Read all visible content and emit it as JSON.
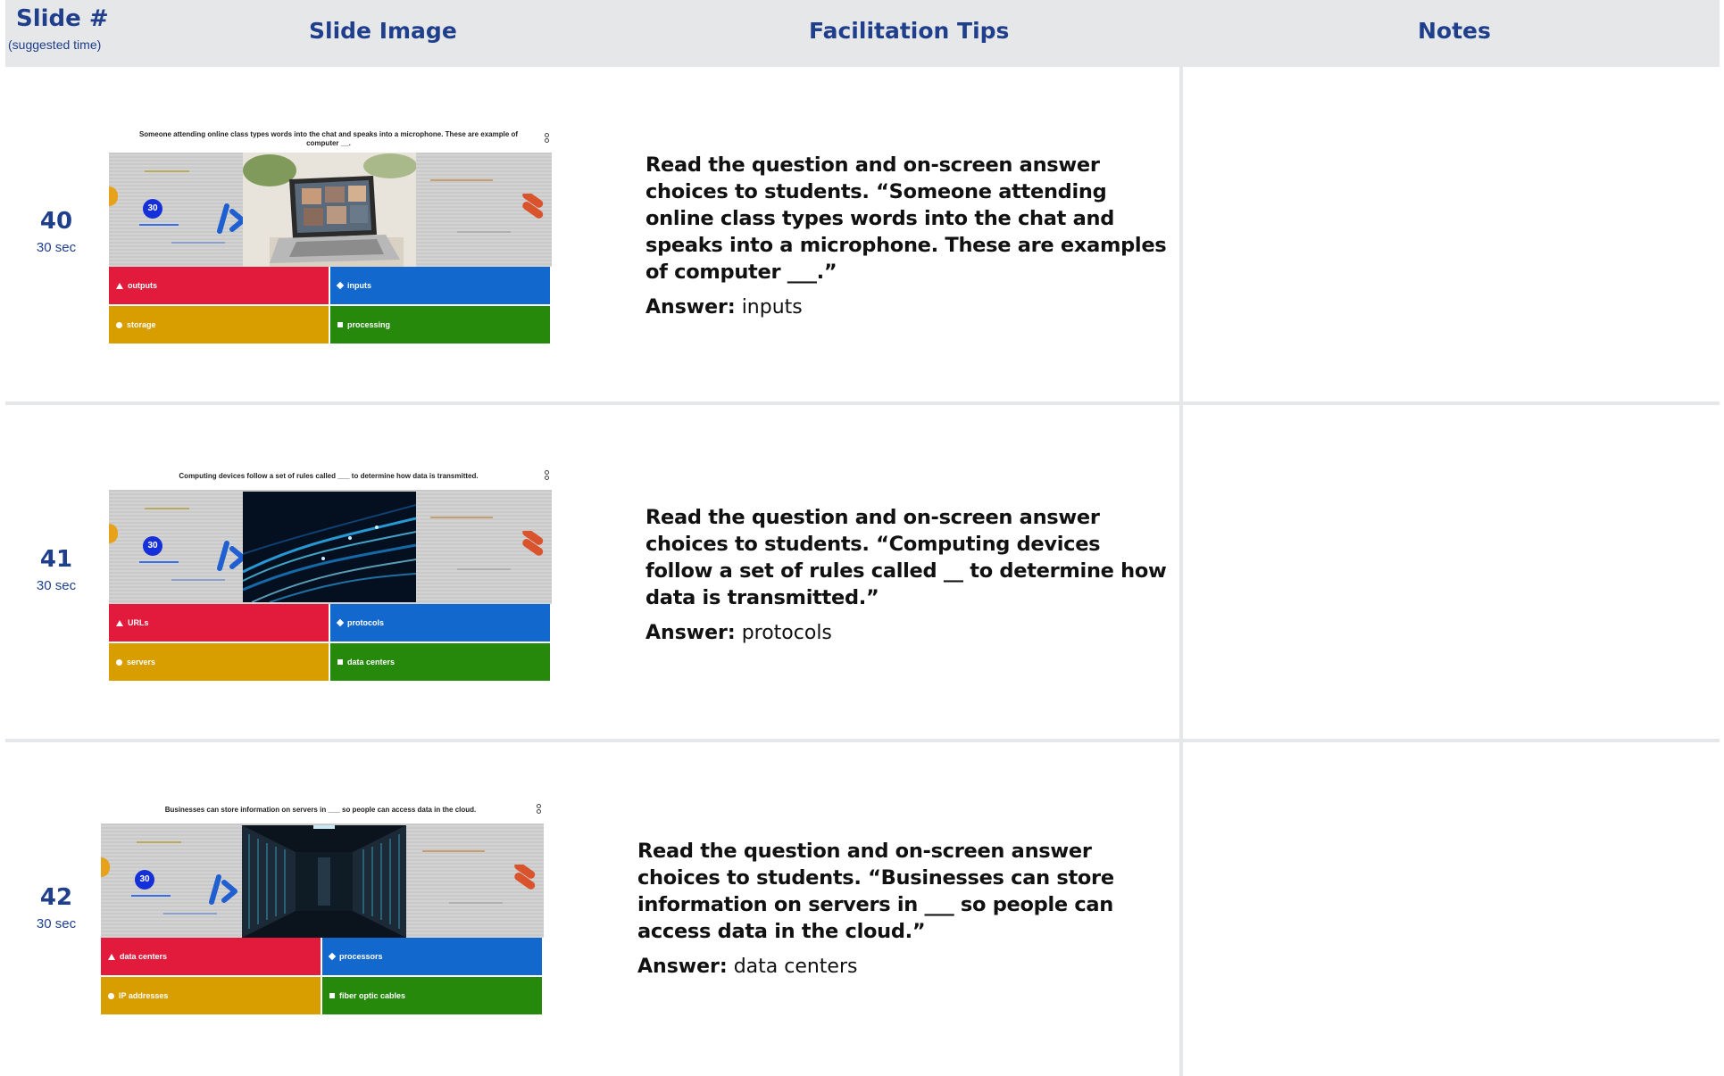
{
  "header": {
    "slide_label": "Slide #",
    "slide_sub": "(suggested time)",
    "image_label": "Slide Image",
    "tips_label": "Facilitation Tips",
    "notes_label": "Notes"
  },
  "rows": [
    {
      "slide_number": "40",
      "time": "30 sec",
      "thumbnail": {
        "question": "Someone attending online class types words into the chat and speaks into a microphone. These are example of computer __.",
        "timer": "30",
        "photo": "laptop-video-call",
        "answers": {
          "red": "outputs",
          "blue": "inputs",
          "yellow": "storage",
          "green": "processing"
        }
      },
      "tip": "Read the question and on-screen answer choices to students. “Someone attending online class types words into the chat and speaks into a microphone. These are examples of computer ___.”",
      "answer_label": "Answer:",
      "answer": "inputs"
    },
    {
      "slide_number": "41",
      "time": "30 sec",
      "thumbnail": {
        "question": "Computing devices follow a set of rules called ___ to determine how data is transmitted.",
        "timer": "30",
        "photo": "fiber-optic-light-streaks",
        "answers": {
          "red": "URLs",
          "blue": "protocols",
          "yellow": "servers",
          "green": "data centers"
        }
      },
      "tip": "Read the question and on-screen answer choices to students. “Computing devices follow a set of rules called __ to determine how data is transmitted.”",
      "answer_label": "Answer:",
      "answer": "protocols"
    },
    {
      "slide_number": "42",
      "time": "30 sec",
      "thumbnail": {
        "question": "Businesses can store information on servers in ___ so people can access data in the cloud.",
        "timer": "30",
        "photo": "server-room",
        "answers": {
          "red": "data centers",
          "blue": "processors",
          "yellow": "IP addresses",
          "green": "fiber optic cables"
        }
      },
      "tip": "Read the question and on-screen answer choices to students. “Businesses can store information on servers in ___ so people can access data in the cloud.”",
      "answer_label": "Answer:",
      "answer": "data centers"
    }
  ],
  "colors": {
    "header_bg": "#e6e7e9",
    "heading_blue": "#1f3f8c",
    "answer_red": "#e21b3c",
    "answer_blue": "#1368ce",
    "answer_yellow": "#d89e00",
    "answer_green": "#26890c"
  }
}
